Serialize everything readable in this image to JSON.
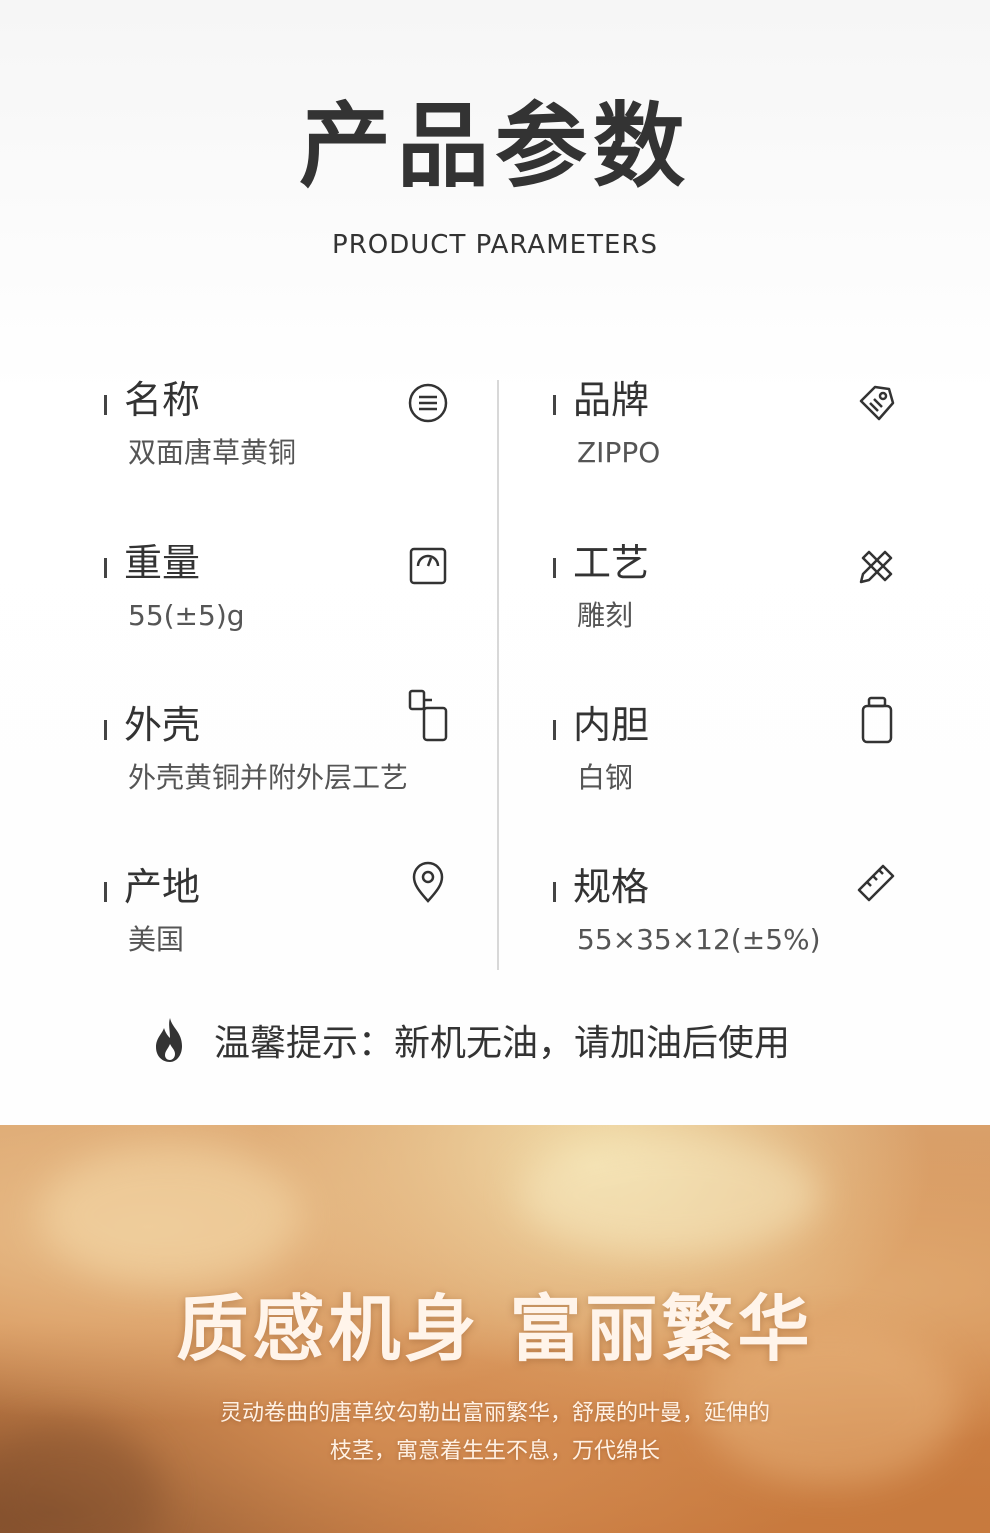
{
  "header": {
    "title": "产品参数",
    "subtitle": "PRODUCT PARAMETERS"
  },
  "params": [
    {
      "label": "名称",
      "value": "双面唐草黄铜",
      "icon": "list-icon"
    },
    {
      "label": "品牌",
      "value": "ZIPPO",
      "icon": "tag-icon"
    },
    {
      "label": "重量",
      "value": "55(±5)g",
      "icon": "scale-icon"
    },
    {
      "label": "工艺",
      "value": "雕刻",
      "icon": "pencil-ruler-icon"
    },
    {
      "label": "外壳",
      "value": "外壳黄铜并附外层工艺",
      "icon": "lighter-shell-icon"
    },
    {
      "label": "内胆",
      "value": "白钢",
      "icon": "inner-case-icon"
    },
    {
      "label": "产地",
      "value": "美国",
      "icon": "location-pin-icon"
    },
    {
      "label": "规格",
      "value": "55×35×12(±5%)",
      "icon": "ruler-icon"
    }
  ],
  "tip": {
    "text": "温馨提示：新机无油，请加油后使用",
    "icon": "flame-icon"
  },
  "hero": {
    "title": "质感机身 富丽繁华",
    "description": "灵动卷曲的唐草纹勾勒出富丽繁华，舒展的叶曼，延伸的枝茎，寓意着生生不息，万代绵长"
  }
}
